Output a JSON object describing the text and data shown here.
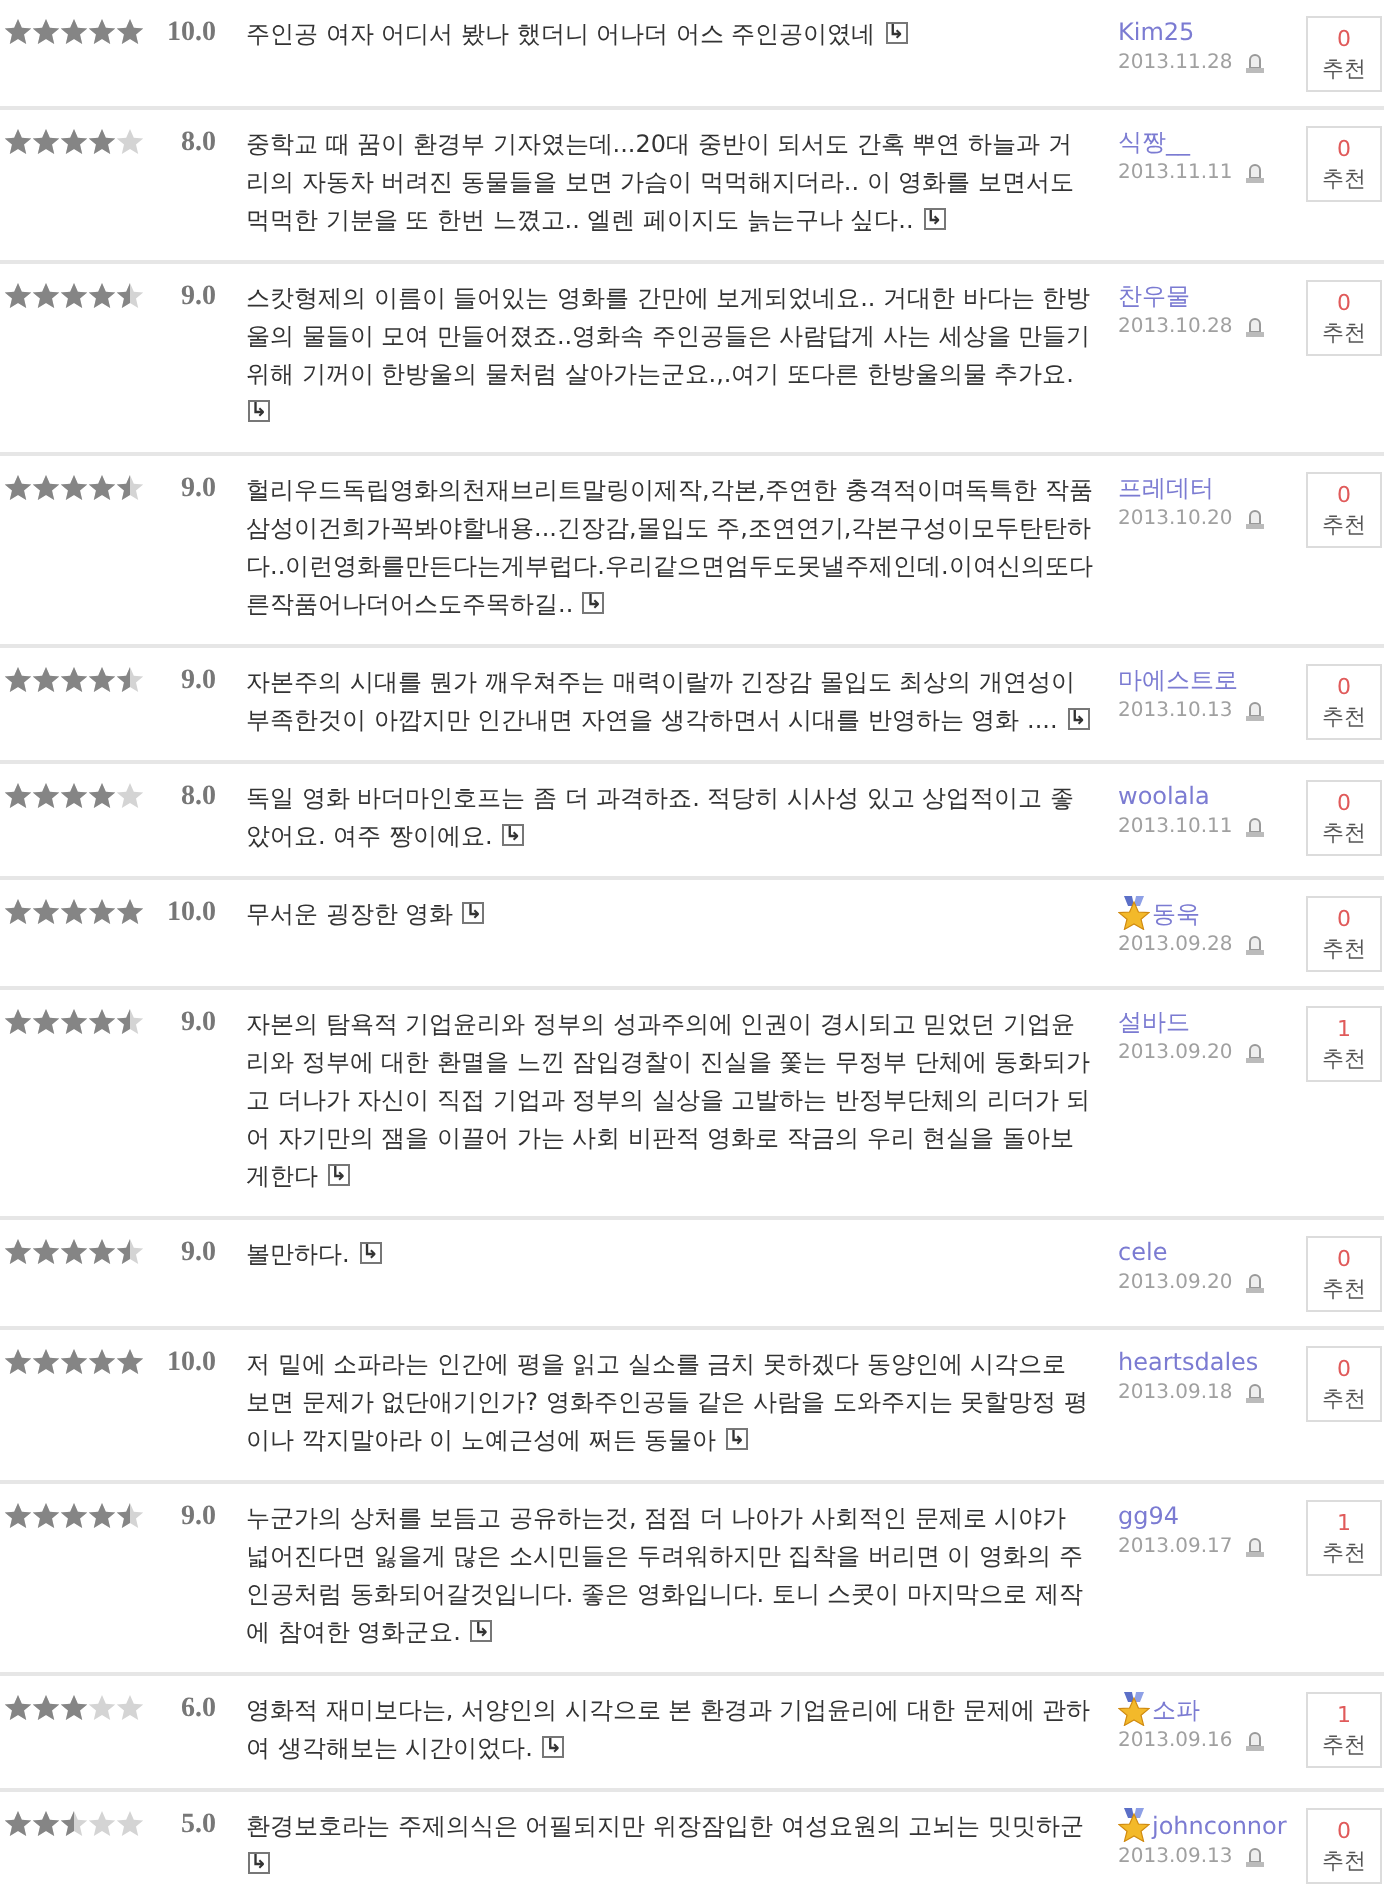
{
  "more_mark": "↳",
  "reviews": [
    {
      "stars": 5,
      "score": "10.0",
      "text": "주인공 여자 어디서 봤나 했더니 어나더 어스 주인공이였네",
      "author": "Kim25",
      "badge": false,
      "date": "2013.11.28",
      "recommend_count": "0",
      "recommend_label": "추천"
    },
    {
      "stars": 4,
      "score": "8.0",
      "text": "중학교 때 꿈이 환경부 기자였는데...20대 중반이 되서도 간혹 뿌연 하늘과 거리의 자동차 버려진 동물들을 보면 가슴이 먹먹해지더라.. 이 영화를 보면서도 먹먹한 기분을 또 한번 느꼈고.. 엘렌 페이지도 늙는구나 싶다..",
      "author": "식짱__",
      "badge": false,
      "date": "2013.11.11",
      "recommend_count": "0",
      "recommend_label": "추천"
    },
    {
      "stars": 4.5,
      "score": "9.0",
      "text": "스캇형제의 이름이 들어있는 영화를 간만에 보게되었네요.. 거대한 바다는 한방울의 물들이 모여 만들어졌죠..영화속 주인공들은 사람답게 사는 세상을 만들기 위해 기꺼이 한방울의 물처럼 살아가는군요.,.여기 또다른 한방울의물 추가요.",
      "author": "찬우물",
      "badge": false,
      "date": "2013.10.28",
      "recommend_count": "0",
      "recommend_label": "추천"
    },
    {
      "stars": 4.5,
      "score": "9.0",
      "text": "헐리우드독립영화의천재브리트말링이제작,각본,주연한 충격적이며독특한 작품 삼성이건희가꼭봐야할내용...긴장감,몰입도 주,조연연기,각본구성이모두탄탄하다..이런영화를만든다는게부럽다.우리같으면엄두도못낼주제인데.이여신의또다른작품어나더어스도주목하길..",
      "author": "프레데터",
      "badge": false,
      "date": "2013.10.20",
      "recommend_count": "0",
      "recommend_label": "추천"
    },
    {
      "stars": 4.5,
      "score": "9.0",
      "text": "자본주의 시대를 뭔가 깨우쳐주는 매력이랄까 긴장감 몰입도 최상의 개연성이 부족한것이 아깝지만 인간내면 자연을 생각하면서 시대를 반영하는 영화 ....",
      "author": "마에스트로",
      "badge": false,
      "date": "2013.10.13",
      "recommend_count": "0",
      "recommend_label": "추천"
    },
    {
      "stars": 4,
      "score": "8.0",
      "text": "독일 영화 바더마인호프는 좀 더 과격하죠. 적당히 시사성 있고 상업적이고 좋았어요. 여주 짱이에요.",
      "author": "woolala",
      "badge": false,
      "date": "2013.10.11",
      "recommend_count": "0",
      "recommend_label": "추천"
    },
    {
      "stars": 5,
      "score": "10.0",
      "text": "무서운 굉장한 영화",
      "author": "동욱",
      "badge": true,
      "date": "2013.09.28",
      "recommend_count": "0",
      "recommend_label": "추천"
    },
    {
      "stars": 4.5,
      "score": "9.0",
      "text": "자본의 탐욕적 기업윤리와 정부의 성과주의에 인권이 경시되고 믿었던 기업윤리와 정부에 대한 환멸을 느낀 잠입경찰이 진실을 쫓는 무정부 단체에 동화되가고 더나가 자신이 직접 기업과 정부의 실상을 고발하는 반정부단체의 리더가 되어 자기만의 잼을 이끌어 가는 사회 비판적 영화로 작금의 우리 현실을 돌아보게한다",
      "author": "설바드",
      "badge": false,
      "date": "2013.09.20",
      "recommend_count": "1",
      "recommend_label": "추천"
    },
    {
      "stars": 4.5,
      "score": "9.0",
      "text": "볼만하다.",
      "author": "cele",
      "badge": false,
      "date": "2013.09.20",
      "recommend_count": "0",
      "recommend_label": "추천"
    },
    {
      "stars": 5,
      "score": "10.0",
      "text": "저 밑에 소파라는 인간에 평을 읽고 실소를 금치 못하겠다 동양인에 시각으로 보면 문제가 없단애기인가? 영화주인공들 같은 사람을 도와주지는 못할망정 평이나 깍지말아라 이 노예근성에 쩌든 동물아",
      "author": "heartsdales",
      "badge": false,
      "date": "2013.09.18",
      "recommend_count": "0",
      "recommend_label": "추천"
    },
    {
      "stars": 4.5,
      "score": "9.0",
      "text": "누군가의 상처를 보듬고 공유하는것, 점점 더 나아가 사회적인 문제로 시야가 넓어진다면 잃을게 많은 소시민들은 두려워하지만 집착을 버리면 이 영화의 주인공처럼 동화되어갈것입니다. 좋은 영화입니다. 토니 스콧이 마지막으로 제작에 참여한 영화군요.",
      "author": "gg94",
      "badge": false,
      "date": "2013.09.17",
      "recommend_count": "1",
      "recommend_label": "추천"
    },
    {
      "stars": 3,
      "score": "6.0",
      "text": "영화적 재미보다는, 서양인의 시각으로 본 환경과 기업윤리에 대한 문제에 관하여 생각해보는 시간이었다.",
      "author": "소파",
      "badge": true,
      "date": "2013.09.16",
      "recommend_count": "1",
      "recommend_label": "추천"
    },
    {
      "stars": 2.5,
      "score": "5.0",
      "text": "환경보호라는 주제의식은 어필되지만 위장잠입한 여성요원의 고뇌는 밋밋하군",
      "author": "johnconnor",
      "badge": true,
      "date": "2013.09.13",
      "recommend_count": "0",
      "recommend_label": "추천"
    }
  ]
}
